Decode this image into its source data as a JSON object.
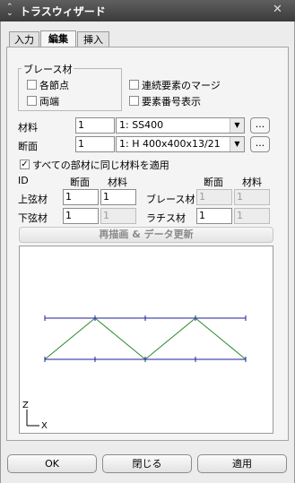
{
  "window": {
    "title": "トラスウィザード",
    "close_glyph": "✕"
  },
  "tabs": [
    {
      "label": "入力"
    },
    {
      "label": "編集"
    },
    {
      "label": "挿入"
    }
  ],
  "brace": {
    "group_title": "ブレース材",
    "all_nodes": "各節点",
    "both_ends": "両端",
    "merge": "連続要素のマージ",
    "show_numbers": "要素番号表示"
  },
  "material": {
    "label": "材料",
    "value": "1",
    "selected": "1: SS400",
    "more": "..."
  },
  "section": {
    "label": "断面",
    "value": "1",
    "selected": "1: H 400x400x13/21",
    "more": "..."
  },
  "same_material": {
    "label": "すべての部材に同じ材料を適用",
    "checked": true
  },
  "table": {
    "h_id": "ID",
    "h_section": "断面",
    "h_material": "材料",
    "h_section2": "断面",
    "h_material2": "材料",
    "upper": {
      "label": "上弦材",
      "section": "1",
      "material": "1"
    },
    "lower": {
      "label": "下弦材",
      "section": "1",
      "material": "1"
    },
    "brace": {
      "label": "ブレース材",
      "section": "1",
      "material": "1"
    },
    "lattice": {
      "label": "ラチス材",
      "section": "1",
      "material": "1"
    }
  },
  "redraw_label": "再描画 & データ更新",
  "viewport": {
    "axis_z": "Z",
    "axis_x": "X",
    "chord_color": "#1c1c9c",
    "web_color": "#2a8a2a"
  },
  "buttons": {
    "ok": "OK",
    "close": "閉じる",
    "apply": "適用"
  }
}
